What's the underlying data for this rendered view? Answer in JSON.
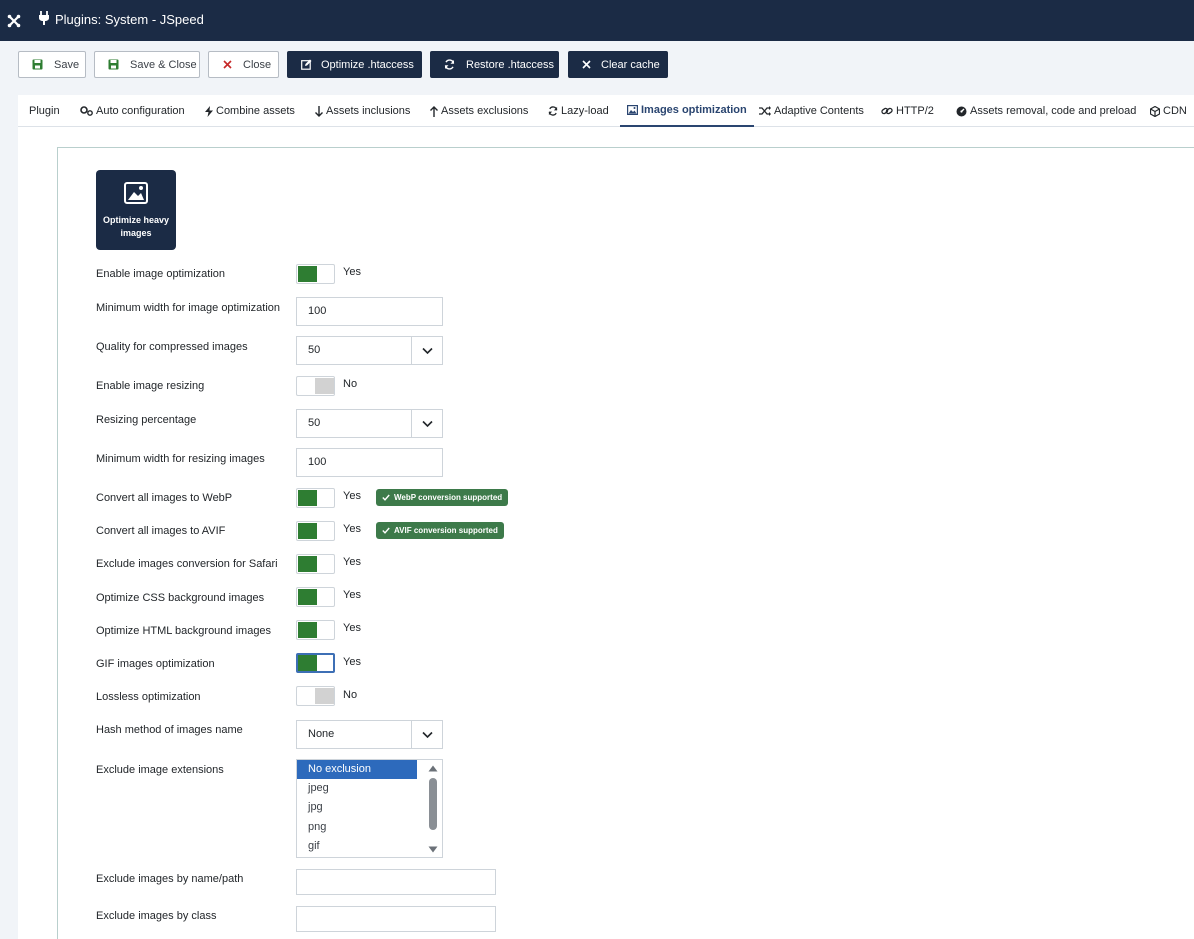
{
  "header": {
    "title": "Plugins: System - JSpeed",
    "logo_icon": "joomla-icon",
    "title_icon": "plug-icon"
  },
  "toolbar": {
    "save": "Save",
    "save_close": "Save & Close",
    "close": "Close",
    "optimize_htaccess": "Optimize .htaccess",
    "restore_htaccess": "Restore .htaccess",
    "clear_cache": "Clear cache"
  },
  "tabs": [
    {
      "label": "Plugin"
    },
    {
      "label": "Auto configuration",
      "icon": "cogs-icon"
    },
    {
      "label": "Combine assets",
      "icon": "bolt-icon"
    },
    {
      "label": "Assets inclusions",
      "icon": "arrow-down-icon"
    },
    {
      "label": "Assets exclusions",
      "icon": "arrow-up-icon"
    },
    {
      "label": "Lazy-load",
      "icon": "refresh-icon"
    },
    {
      "label": "Images optimization",
      "icon": "image-icon",
      "active": true
    },
    {
      "label": "Adaptive Contents",
      "icon": "shuffle-icon"
    },
    {
      "label": "HTTP/2",
      "icon": "link-icon"
    },
    {
      "label": "Assets removal, code and preload",
      "icon": "dashboard-icon"
    },
    {
      "label": "CDN",
      "icon": "cube-icon"
    }
  ],
  "optimize_button": {
    "line1": "Optimize heavy",
    "line2": "images",
    "icon": "image-icon"
  },
  "fields": {
    "enable_opt": {
      "label": "Enable image optimization",
      "state": "Yes"
    },
    "min_width_opt": {
      "label": "Minimum width for image optimization",
      "value": "100"
    },
    "quality": {
      "label": "Quality for compressed images",
      "value": "50"
    },
    "enable_resize": {
      "label": "Enable image resizing",
      "state": "No"
    },
    "resize_pct": {
      "label": "Resizing percentage",
      "value": "50"
    },
    "min_width_resize": {
      "label": "Minimum width for resizing images",
      "value": "100"
    },
    "webp": {
      "label": "Convert all images to WebP",
      "state": "Yes",
      "badge": "WebP conversion supported"
    },
    "avif": {
      "label": "Convert all images to AVIF",
      "state": "Yes",
      "badge": "AVIF conversion supported"
    },
    "safari": {
      "label": "Exclude images conversion for Safari",
      "state": "Yes"
    },
    "css_bg": {
      "label": "Optimize CSS background images",
      "state": "Yes"
    },
    "html_bg": {
      "label": "Optimize HTML background images",
      "state": "Yes"
    },
    "gif": {
      "label": "GIF images optimization",
      "state": "Yes"
    },
    "lossless": {
      "label": "Lossless optimization",
      "state": "No"
    },
    "hash": {
      "label": "Hash method of images name",
      "value": "None"
    },
    "exclude_ext": {
      "label": "Exclude image extensions",
      "options": [
        "No exclusion",
        "jpeg",
        "jpg",
        "png",
        "gif"
      ]
    },
    "exclude_name": {
      "label": "Exclude images by name/path",
      "value": ""
    },
    "exclude_class": {
      "label": "Exclude images by class",
      "value": ""
    }
  },
  "colors": {
    "header_bg": "#1b2b45",
    "switch_on": "#2e7d32",
    "badge_bg": "#3d7a4a",
    "selected_option": "#2d6abc"
  }
}
